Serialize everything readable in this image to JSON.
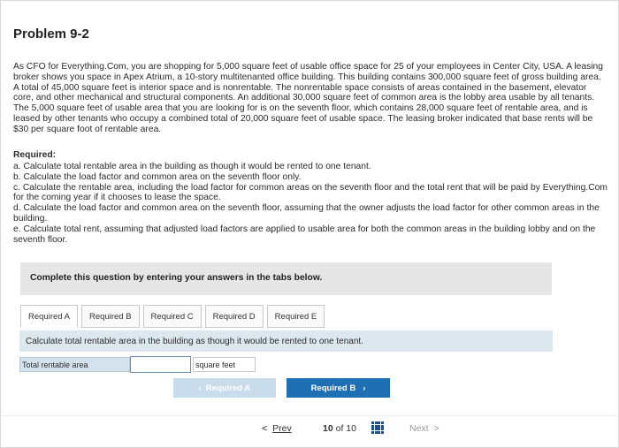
{
  "problem_title": "Problem 9-2",
  "body_paragraph": "As CFO for Everything.Com, you are shopping for 5,000 square feet of usable office space for 25 of your employees in Center City, USA. A leasing broker shows you space in Apex Atrium, a 10-story multitenanted office building. This building contains 300,000 square feet of gross building area. A total of 45,000 square feet is interior space and is nonrentable. The nonrentable space consists of areas contained in the basement, elevator core, and other mechanical and structural components. An additional 30,000 square feet of common area is the lobby area usable by all tenants. The 5,000 square feet of usable area that you are looking for is on the seventh floor, which contains 28,000 square feet of rentable area, and is leased by other tenants who occupy a combined total of 20,000 square feet of usable space. The leasing broker indicated that base rents will be $30 per square foot of rentable area.",
  "required_heading": "Required:",
  "required_items": [
    "a. Calculate total rentable area in the building as though it would be rented to one tenant.",
    "b. Calculate the load factor and common area on the seventh floor only.",
    "c. Calculate the rentable area, including the load factor for common areas on the seventh floor and the total rent that will be paid by Everything.Com for the coming year if it chooses to lease the space.",
    "d. Calculate the load factor and common area on the seventh floor, assuming that the owner adjusts the load factor for other common areas in the building.",
    "e. Calculate total rent, assuming that adjusted load factors are applied to usable area for both the common areas in the building lobby and on the seventh floor."
  ],
  "panel_text": "Complete this question by entering your answers in the tabs below.",
  "tabs": [
    {
      "label": "Required A"
    },
    {
      "label": "Required B"
    },
    {
      "label": "Required C"
    },
    {
      "label": "Required D"
    },
    {
      "label": "Required E"
    }
  ],
  "instruction": "Calculate total rentable area in the building as though it would be rented to one tenant.",
  "answer": {
    "label": "Total rentable area",
    "value": "",
    "unit": "square feet"
  },
  "nav": {
    "prev_required": "Required A",
    "next_required": "Required B"
  },
  "pager": {
    "prev": "Prev",
    "current": "10",
    "of": "of",
    "total": "10",
    "next": "Next"
  },
  "colors": {
    "accent": "#1f6fb5",
    "panel": "#e6e6e6",
    "instruction_bg": "#dde8ee"
  }
}
